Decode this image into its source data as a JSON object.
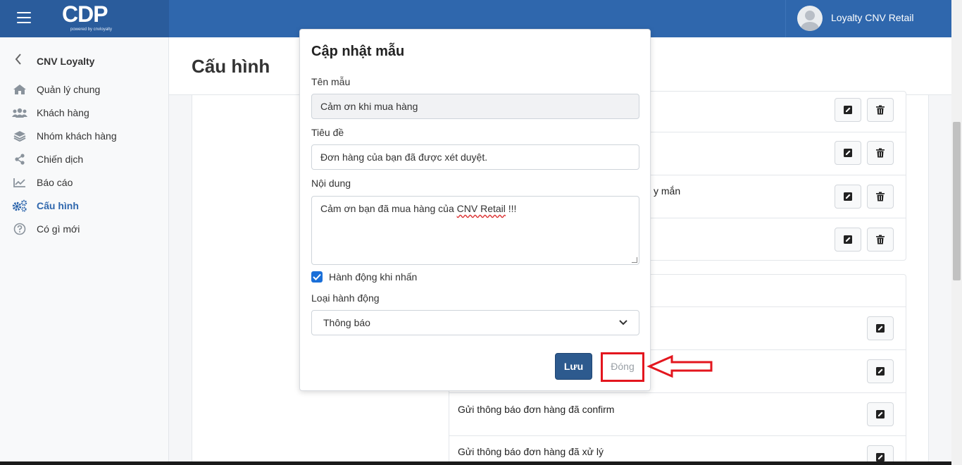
{
  "header": {
    "logo": "CDP",
    "logo_sub": "powered by cnvloyalty",
    "username": "Loyalty CNV Retail"
  },
  "sidebar": {
    "title": "CNV Loyalty",
    "items": [
      {
        "label": "Quản lý chung",
        "icon": "home-icon"
      },
      {
        "label": "Khách hàng",
        "icon": "users-icon"
      },
      {
        "label": "Nhóm khách hàng",
        "icon": "layers-icon"
      },
      {
        "label": "Chiến dịch",
        "icon": "share-icon"
      },
      {
        "label": "Báo cáo",
        "icon": "chart-icon"
      },
      {
        "label": "Cấu hình",
        "icon": "gears-icon",
        "active": true
      },
      {
        "label": "Có gì mới",
        "icon": "help-icon"
      }
    ]
  },
  "page": {
    "title": "Cấu hình"
  },
  "background_rows": {
    "partial_text": "y mắn",
    "rows": [
      "Gửi thông báo đơn hàng đã confirm",
      "Gửi thông báo đơn hàng đã xử lý"
    ]
  },
  "modal": {
    "title": "Cập nhật mẫu",
    "name_label": "Tên mẫu",
    "name_value": "Cảm ơn khi mua hàng",
    "subject_label": "Tiêu đề",
    "subject_value": "Đơn hàng của bạn đã được xét duyệt.",
    "content_label": "Nội dung",
    "content_pre": "Cảm ơn bạn đã mua hàng của ",
    "content_mark": "CNV Retail",
    "content_post": " !!!",
    "checkbox_label": "Hành động khi nhấn",
    "checkbox_checked": true,
    "action_type_label": "Loại hành động",
    "action_type_value": "Thông báo",
    "save_label": "Lưu",
    "close_label": "Đóng"
  },
  "colors": {
    "topbar": "#2f67ad",
    "primary_button": "#2d5a8e",
    "annotation": "#e3161e"
  }
}
